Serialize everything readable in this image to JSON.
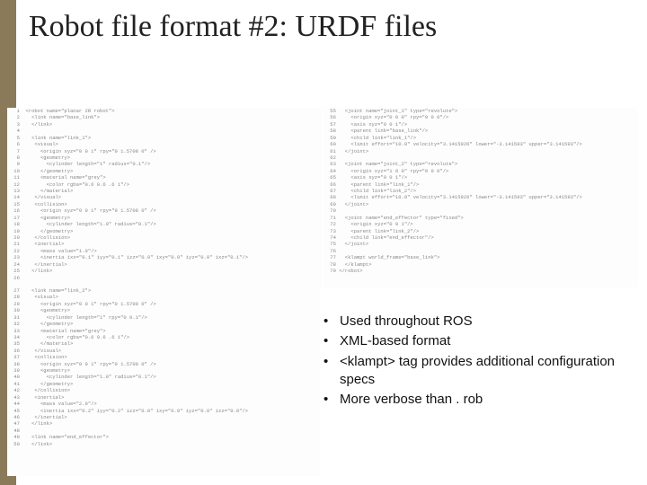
{
  "slide": {
    "title": "Robot file format #2: URDF files"
  },
  "bullets": [
    "Used throughout ROS",
    "XML-based format",
    "<klampt> tag provides additional configuration specs",
    "More verbose than . rob"
  ],
  "code_left": "  1  <robot name=\"planar 2R robot\">\n  2    <link name=\"base_link\">\n  3    </link>\n  4\n  5    <link name=\"link_1\">\n  6     <visual>\n  7       <origin xyz=\"0 0 1\" rpy=\"0 1.5708 0\" />\n  8       <geometry>\n  9         <cylinder length=\"1\" radius=\"0.1\"/>\n 10       </geometry>\n 11       <material name=\"grey\">\n 12         <color rgba=\"0.6 0.6 .6 1\"/>\n 13       </material>\n 14     </visual>\n 15     <collision>\n 16       <origin xyz=\"0 0 1\" rpy=\"0 1.5708 0\" />\n 17       <geometry>\n 18         <cylinder length=\"1.0\" radius=\"0.1\"/>\n 19       </geometry>\n 20     </collision>\n 21     <inertial>\n 22       <mass value=\"1.0\"/>\n 23       <inertia ixx=\"0.1\" iyy=\"0.1\" izz=\"0.0\" ixy=\"0.0\" iyz=\"0.0\" ixz=\"0.1\"/>\n 24     </inertial>\n 25    </link>\n 26",
  "code_lower_left": " 27    <link name=\"link_2\">\n 28     <visual>\n 29       <origin xyz=\"0 0 1\" rpy=\"0 1.5700 0\" />\n 30       <geometry>\n 31         <cylinder length=\"1\" rpy=\"0 0.1\"/>\n 32       </geometry>\n 33       <material name=\"grey\">\n 34         <color rgba=\"0.6 0.6 .6 1\"/>\n 35       </material>\n 36     </visual>\n 37     <collision>\n 38       <origin xyz=\"0 0 1\" rpy=\"0 1.5700 0\" />\n 39       <geometry>\n 40         <cylinder length=\"1.0\" radius=\"0.1\"/>\n 41       </geometry>\n 42     </collision>\n 43     <inertial>\n 44       <mass value=\"2.0\"/>\n 45       <inertia ixx=\"0.2\" iyy=\"0.2\" izz=\"0.0\" ixy=\"0.0\" iyz=\"0.0\" ixz=\"0.0\"/>\n 46     </inertial>\n 47    </link>\n 48\n 49    <link name=\"end_effector\">\n 50    </link>",
  "code_right": " 55   <joint name=\"joint_1\" type=\"revolute\">\n 56     <origin xyz=\"0 0 0\" rpy=\"0 0 0\"/>\n 57     <axis xyz=\"0 0 1\"/>\n 58     <parent link=\"base_link\"/>\n 59     <child link=\"link_1\"/>\n 60     <limit effort=\"10.0\" velocity=\"3.1415926\" lower=\"-3.141593\" upper=\"3.141593\"/>\n 61   </joint>\n 62\n 63   <joint name=\"joint_2\" type=\"revolute\">\n 64     <origin xyz=\"1 0 0\" rpy=\"0 0 0\"/>\n 65     <axis xyz=\"0 0 1\"/>\n 66     <parent link=\"link_1\"/>\n 67     <child link=\"link_2\"/>\n 68     <limit effort=\"10.0\" velocity=\"3.1415926\" lower=\"-3.141593\" upper=\"3.141593\"/>\n 69   </joint>\n 70\n 71   <joint name=\"end_effector\" type=\"fixed\">\n 72     <origin xyz=\"0 0 1\"/>\n 73     <parent link=\"link_2\"/>\n 74     <child link=\"end_effector\"/>\n 75   </joint>\n 76\n 77   <klampt world_frame=\"base_link\">\n 78   </klampt>\n 79 </robot>"
}
